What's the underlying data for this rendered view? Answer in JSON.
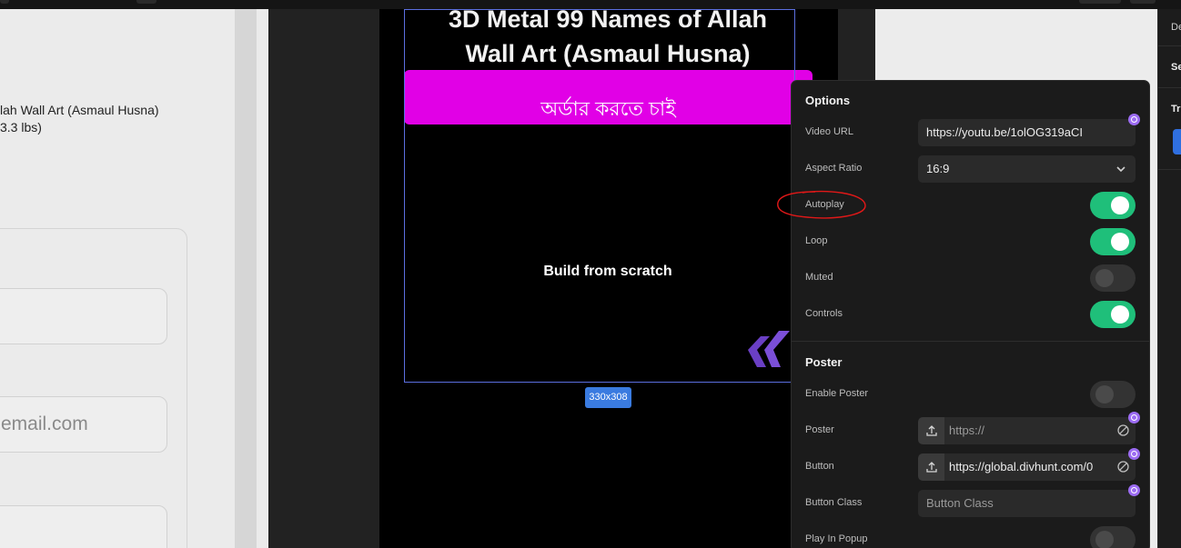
{
  "left_page": {
    "product_title_line1": "lah Wall Art (Asmaul Husna)",
    "product_title_line2": "3.3 lbs)",
    "email_placeholder": "email.com"
  },
  "canvas": {
    "heading_line1": "3D Metal 99 Names of Allah",
    "heading_line2": "Wall Art (Asmaul Husna)",
    "order_button": "অর্ডার করতে চাই",
    "video_caption": "Build from scratch",
    "size_badge": "330x308"
  },
  "options_panel": {
    "options_title": "Options",
    "video_url_label": "Video URL",
    "video_url_value": "https://youtu.be/1olOG319aCI",
    "aspect_ratio_label": "Aspect Ratio",
    "aspect_ratio_value": "16:9",
    "autoplay_label": "Autoplay",
    "autoplay_on": true,
    "loop_label": "Loop",
    "loop_on": true,
    "muted_label": "Muted",
    "muted_on": false,
    "controls_label": "Controls",
    "controls_on": true,
    "poster_title": "Poster",
    "enable_poster_label": "Enable Poster",
    "enable_poster_on": false,
    "poster_label": "Poster",
    "poster_placeholder": "https://",
    "button_label": "Button",
    "button_value": "https://global.divhunt.com/0",
    "button_class_label": "Button Class",
    "button_class_placeholder": "Button Class",
    "play_in_popup_label": "Play In Popup",
    "play_in_popup_on": false
  },
  "right_strip": {
    "text1": "De",
    "text2": "Se",
    "text3": "Tr"
  },
  "colors": {
    "order_button": "#e100e6",
    "toggle_on": "#1fbf7a",
    "dynamic_dot": "#9c6cf2",
    "size_badge": "#3a7be0",
    "annotation": "#e01818"
  }
}
